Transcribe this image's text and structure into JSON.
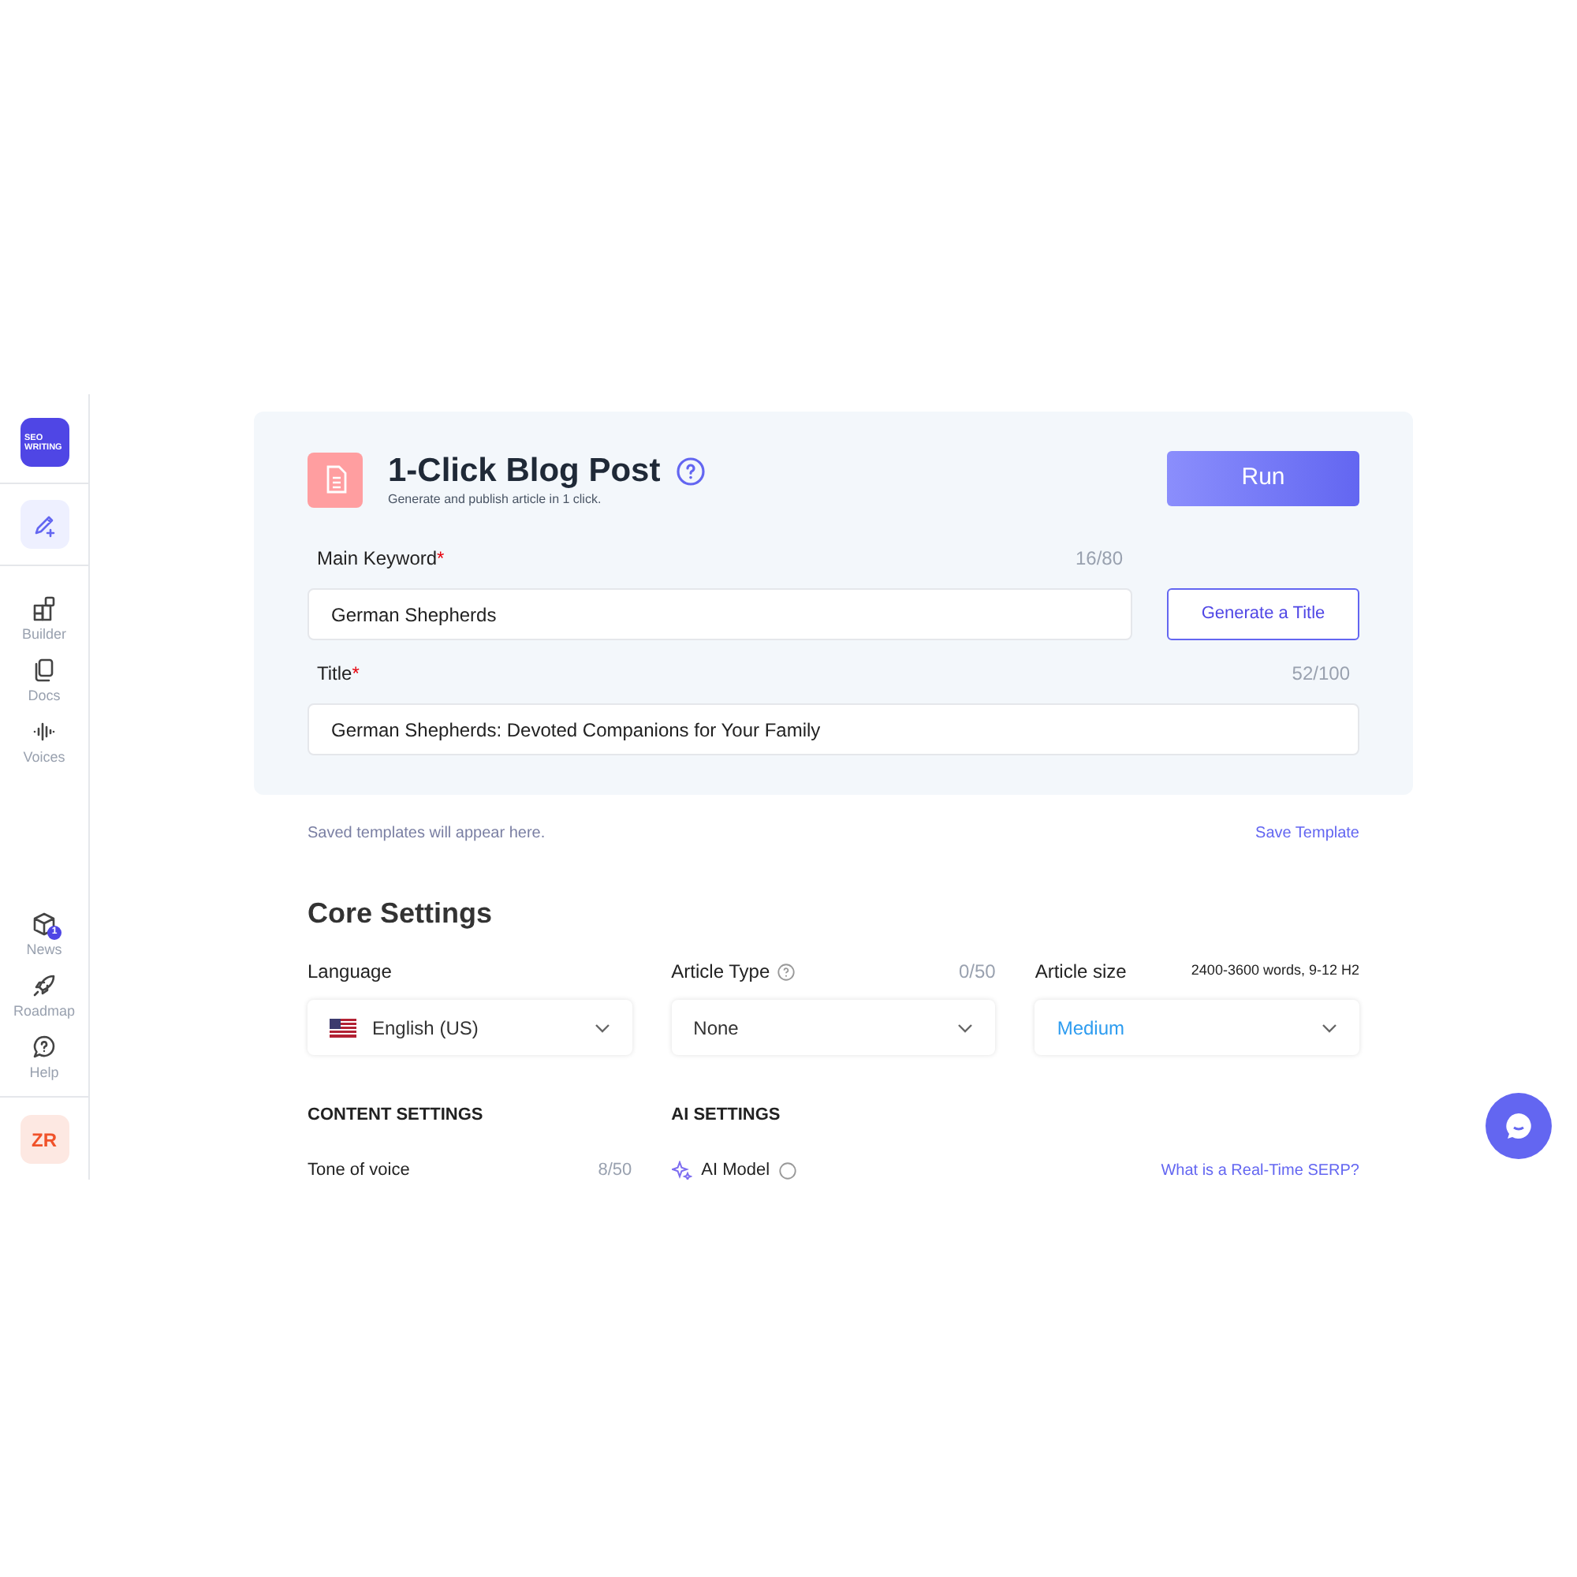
{
  "sidebar": {
    "logo": [
      "SEO",
      "WRITING"
    ],
    "create_button": {
      "selected": true
    },
    "nav_top": [
      {
        "label": "Builder"
      },
      {
        "label": "Docs"
      },
      {
        "label": "Voices"
      }
    ],
    "nav_bottom": [
      {
        "label": "News",
        "badge": "1"
      },
      {
        "label": "Roadmap"
      },
      {
        "label": "Help"
      }
    ],
    "avatar": "ZR"
  },
  "header": {
    "title": "1-Click Blog Post",
    "subtitle": "Generate and publish article in 1 click.",
    "run_button": "Run"
  },
  "main_keyword": {
    "label": "Main Keyword",
    "required": "*",
    "counter": "16/80",
    "value": "German Shepherds",
    "button": "Generate a Title"
  },
  "title_field": {
    "label": "Title",
    "required": "*",
    "counter": "52/100",
    "value": "German Shepherds: Devoted Companions for Your Family"
  },
  "templates": {
    "note": "Saved templates will appear here.",
    "save_link": "Save Template"
  },
  "core_settings": {
    "heading": "Core Settings",
    "fields": [
      {
        "label": "Language",
        "value": "English (US)",
        "flag": true,
        "help": false,
        "highlight": false
      },
      {
        "label": "Article Type",
        "value": "None",
        "flag": false,
        "help": true,
        "aside": "0/50",
        "highlight": false
      },
      {
        "label": "Article size",
        "value": "Medium",
        "flag": false,
        "help": false,
        "aside": "2400-3600 words, 9-12 H2",
        "highlight": true
      }
    ]
  },
  "content_settings": {
    "heading": "CONTENT SETTINGS",
    "field_label": "Tone of voice",
    "counter": "8/50"
  },
  "ai_settings": {
    "heading": "AI SETTINGS",
    "field_label": "AI Model",
    "link": "What is a Real-Time SERP?"
  }
}
